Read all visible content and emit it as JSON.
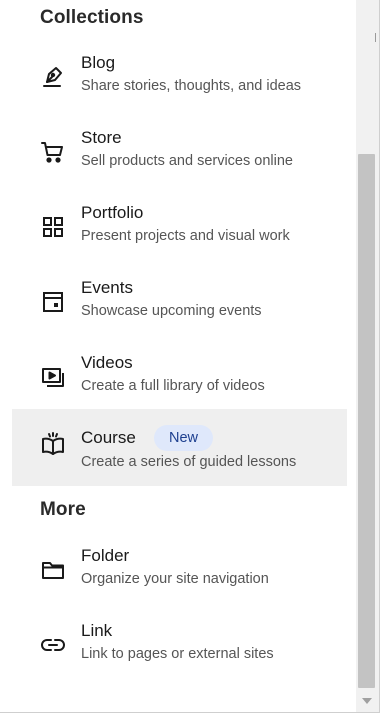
{
  "collections": {
    "heading": "Collections",
    "items": [
      {
        "title": "Blog",
        "description": "Share stories, thoughts, and ideas",
        "icon": "pen-nib-icon"
      },
      {
        "title": "Store",
        "description": "Sell products and services online",
        "icon": "shopping-cart-icon"
      },
      {
        "title": "Portfolio",
        "description": "Present projects and visual work",
        "icon": "grid-icon"
      },
      {
        "title": "Events",
        "description": "Showcase upcoming events",
        "icon": "calendar-icon"
      },
      {
        "title": "Videos",
        "description": "Create a full library of videos",
        "icon": "video-library-icon"
      },
      {
        "title": "Course",
        "description": "Create a series of guided lessons",
        "icon": "open-book-icon",
        "badge": "New",
        "selected": true
      }
    ]
  },
  "more": {
    "heading": "More",
    "items": [
      {
        "title": "Folder",
        "description": "Organize your site navigation",
        "icon": "folder-icon"
      },
      {
        "title": "Link",
        "description": "Link to pages or external sites",
        "icon": "link-icon"
      }
    ]
  },
  "colors": {
    "selected_background": "#efefef",
    "badge_background": "#dfe8fb",
    "badge_text": "#1d3f8f"
  }
}
